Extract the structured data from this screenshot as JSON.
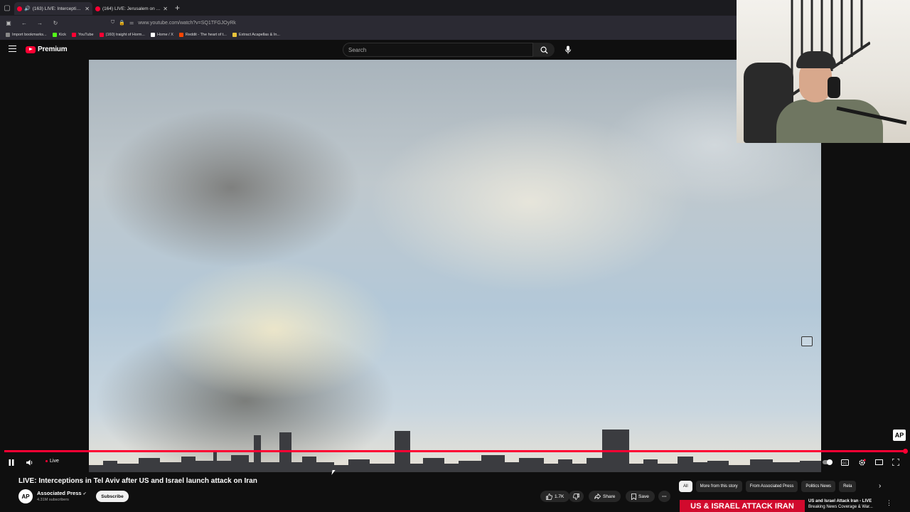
{
  "browser": {
    "tabs": [
      {
        "title": "(163) LIVE: Interceptions in",
        "active": true,
        "audio": true
      },
      {
        "title": "(164) LIVE: Jerusalem on Alert a",
        "active": false,
        "audio": false
      }
    ],
    "address": "www.youtube.com/watch?v=SQ1TFGJOyRk",
    "bookmarks": [
      {
        "label": "Import bookmarks...",
        "color": "#888888"
      },
      {
        "label": "Kick",
        "color": "#53fc18"
      },
      {
        "label": "YouTube",
        "color": "#ff0033"
      },
      {
        "label": "(160) traight of Horm...",
        "color": "#ff0033"
      },
      {
        "label": "Home / X",
        "color": "#ffffff"
      },
      {
        "label": "Reddit - The heart of t...",
        "color": "#ff4500"
      },
      {
        "label": "Extract Acapellas & In...",
        "color": "#e8c33a"
      }
    ]
  },
  "youtube": {
    "logo_text": "Premium",
    "search_placeholder": "Search"
  },
  "player": {
    "live_label": "Live",
    "progress_fraction": 1.0,
    "watermark": "AP"
  },
  "video_info": {
    "title": "LIVE: Interceptions in Tel Aviv after US and Israel launch attack on Iran",
    "channel": "Associated Press",
    "channel_avatar": "AP",
    "subscribers": "4.31M subscribers",
    "subscribe_label": "Subscribe",
    "likes": "1.7K",
    "share_label": "Share",
    "save_label": "Save"
  },
  "chips": [
    "All",
    "More from this story",
    "From Associated Press",
    "Politics News",
    "Rela"
  ],
  "recommendation": {
    "banner": "US & ISRAEL ATTACK IRAN",
    "title": "US and Israel Attack Iran - LIVE",
    "subtitle": "Breaking News Coverage & War..."
  },
  "colors": {
    "accent": "#ff0033",
    "background": "#0f0f0f",
    "banner": "#d10a2d"
  }
}
